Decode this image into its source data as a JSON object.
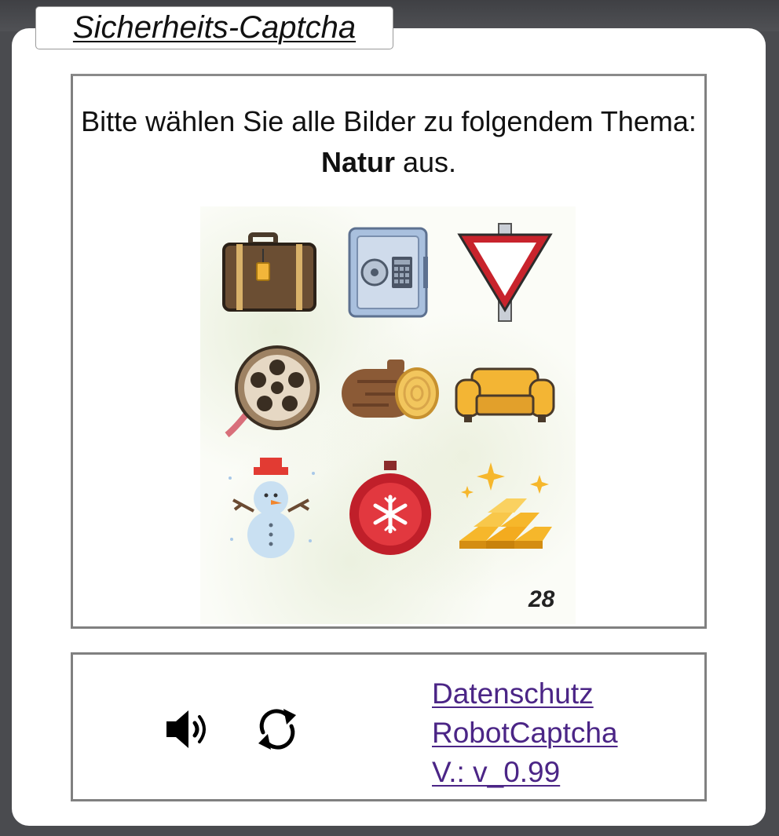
{
  "dialog": {
    "title": "Sicherheits-Captcha"
  },
  "captcha": {
    "instruction_prefix": "Bitte wählen Sie alle Bilder zu folgendem Thema: ",
    "topic": "Natur",
    "instruction_suffix": " aus.",
    "image_number": "28",
    "images": [
      {
        "icon": "suitcase-icon"
      },
      {
        "icon": "safe-icon"
      },
      {
        "icon": "yield-sign-icon"
      },
      {
        "icon": "film-reel-icon"
      },
      {
        "icon": "log-icon"
      },
      {
        "icon": "sofa-icon"
      },
      {
        "icon": "snowman-icon"
      },
      {
        "icon": "christmas-ornament-icon"
      },
      {
        "icon": "gold-bars-icon"
      }
    ]
  },
  "controls": {
    "audio_icon": "speaker-icon",
    "refresh_icon": "refresh-icon",
    "privacy_link": "Datenschutz",
    "brand_link": "RobotCaptcha",
    "version_link": "V.: v_0.99"
  },
  "colors": {
    "link": "#4b2586",
    "backdrop": "#4a4b4f",
    "box_border": "#808080"
  }
}
